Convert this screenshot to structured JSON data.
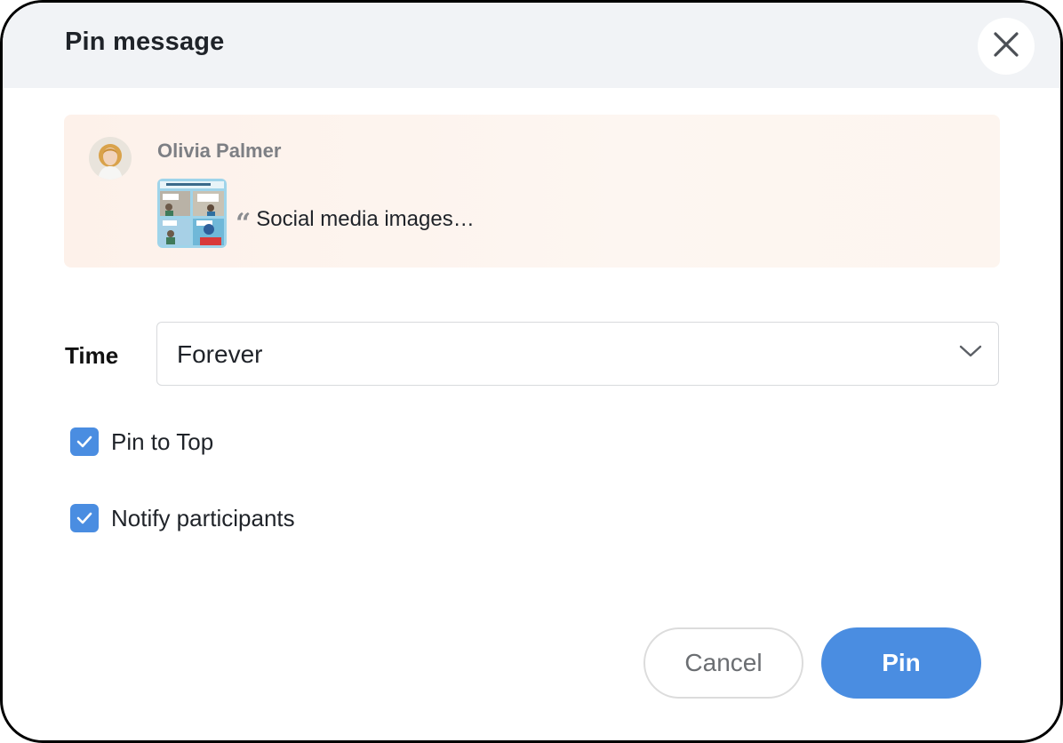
{
  "dialog": {
    "title": "Pin message",
    "close_icon": "close-icon"
  },
  "preview": {
    "author": "Olivia Palmer",
    "quote_icon": "quote-icon",
    "message": "Social media images…"
  },
  "time": {
    "label": "Time",
    "selected": "Forever",
    "chevron_icon": "chevron-down-icon"
  },
  "options": [
    {
      "label": "Pin to Top",
      "checked": true
    },
    {
      "label": "Notify participants",
      "checked": true
    }
  ],
  "buttons": {
    "cancel": "Cancel",
    "pin": "Pin"
  },
  "colors": {
    "accent": "#4a8de1",
    "header_bg": "#f1f3f6",
    "preview_bg": "#fdf3ec"
  }
}
